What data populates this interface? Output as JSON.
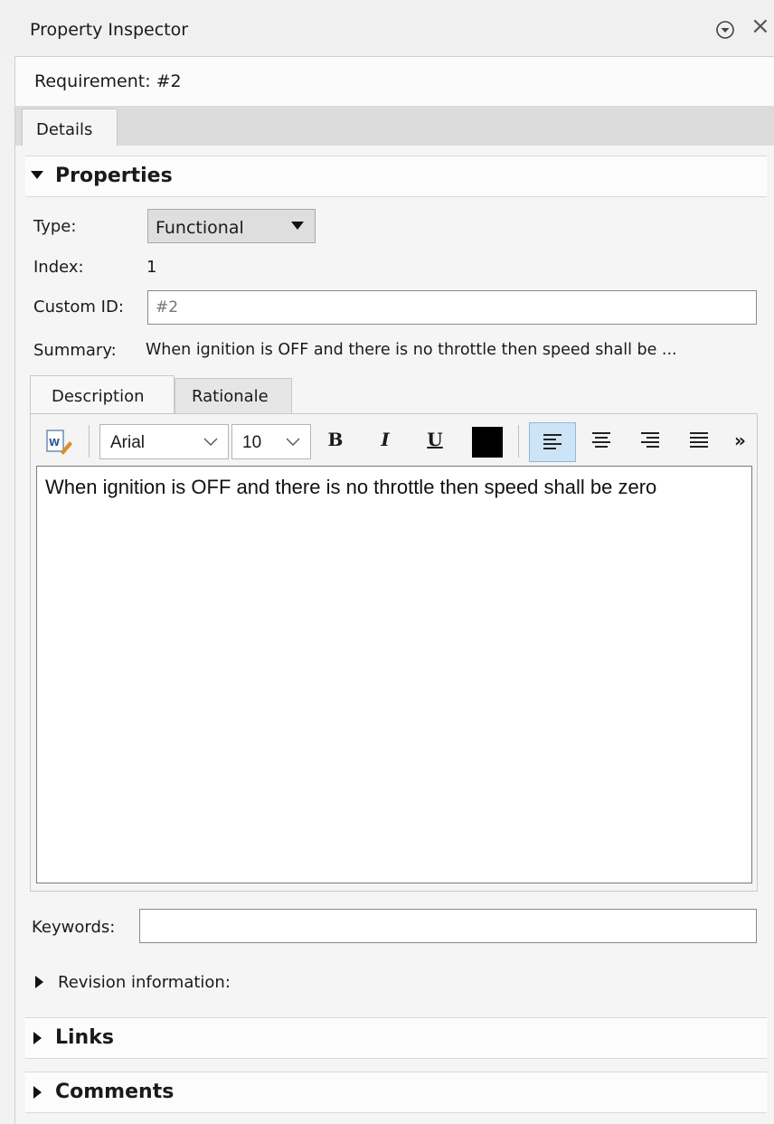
{
  "window": {
    "title": "Property Inspector"
  },
  "header": {
    "requirement": "Requirement: #2"
  },
  "tabs": [
    {
      "label": "Details"
    }
  ],
  "properties": {
    "section_title": "Properties",
    "type_label": "Type:",
    "type_value": "Functional",
    "index_label": "Index:",
    "index_value": "1",
    "custom_id_label": "Custom ID:",
    "custom_id_placeholder": "#2",
    "summary_label": "Summary:",
    "summary_value": "When ignition is OFF and there is no throttle then speed shall be ..."
  },
  "editor": {
    "tabs": [
      {
        "label": "Description"
      },
      {
        "label": "Rationale"
      }
    ],
    "font_family": "Arial",
    "font_size": "10",
    "bold_label": "B",
    "italic_label": "I",
    "underline_label": "U",
    "more_label": "»",
    "text_color": "#000000",
    "content": "When ignition is OFF and there is no throttle then speed shall be zero"
  },
  "keywords": {
    "label": "Keywords:",
    "value": ""
  },
  "revision": {
    "label": "Revision information:"
  },
  "sections": {
    "links": "Links",
    "comments": "Comments"
  },
  "icons": {
    "collapse": "chevron-circle-down-icon",
    "close": "close-icon",
    "word": "word-document-icon"
  }
}
